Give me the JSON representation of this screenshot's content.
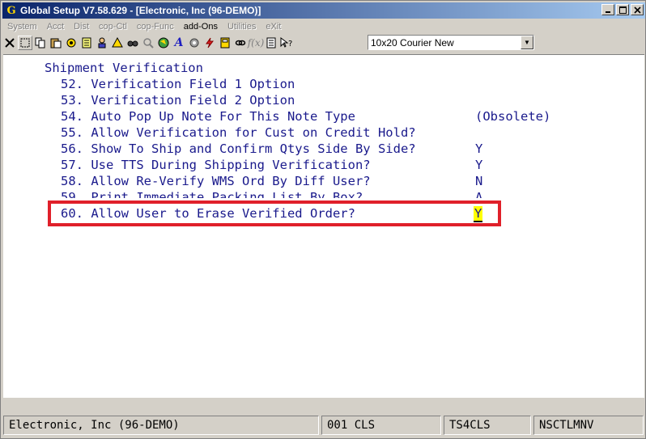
{
  "window": {
    "title": "Global Setup V7.58.629 - [Electronic, Inc (96-DEMO)]",
    "app_icon": "app-logo-icon",
    "buttons": [
      "minimize",
      "maximize",
      "close"
    ]
  },
  "menu": {
    "items": [
      {
        "label": "System",
        "active": false
      },
      {
        "label": "Acct",
        "active": false
      },
      {
        "label": "Dist",
        "active": false
      },
      {
        "label": "cop-Ctl",
        "active": false
      },
      {
        "label": "cop-Func",
        "active": false
      },
      {
        "label": "add-Ons",
        "active": true
      },
      {
        "label": "Utilities",
        "active": false
      },
      {
        "label": "eXit",
        "active": false
      }
    ]
  },
  "toolbar": {
    "icons": [
      "close-x-icon",
      "select-icon",
      "copy-icon",
      "paste-icon",
      "settings-icon",
      "notes-icon",
      "user-icon",
      "alert-icon",
      "find-icon",
      "search-icon",
      "globe-icon",
      "font-icon",
      "gear-icon",
      "lightning-icon",
      "calculator-icon",
      "link-icon",
      "function-icon",
      "list-icon",
      "help-pointer-icon"
    ],
    "font_select": "10x20 Courier New"
  },
  "screen": {
    "section_title": "Shipment Verification",
    "lines": [
      {
        "num": "52.",
        "text": "Verification Field 1 Option",
        "answer": ""
      },
      {
        "num": "53.",
        "text": "Verification Field 2 Option",
        "answer": ""
      },
      {
        "num": "54.",
        "text": "Auto Pop Up Note For This Note Type",
        "answer": "(Obsolete)"
      },
      {
        "num": "55.",
        "text": "Allow Verification for Cust on Credit Hold?",
        "answer": ""
      },
      {
        "num": "56.",
        "text": "Show To Ship and Confirm Qtys Side By Side?",
        "answer": "Y"
      },
      {
        "num": "57.",
        "text": "Use TTS During Shipping Verification?",
        "answer": "Y"
      },
      {
        "num": "58.",
        "text": "Allow Re-Verify WMS Ord By Diff User?",
        "answer": "N"
      },
      {
        "num": "59.",
        "text": "Print Immediate Packing List By Box?",
        "answer": "A"
      }
    ],
    "current": {
      "num": "60.",
      "text": "Allow User to Erase Verified Order?",
      "answer": "Y"
    }
  },
  "status": {
    "company": "Electronic, Inc (96-DEMO)",
    "code": "001 CLS",
    "terminal": "TS4CLS",
    "program": "NSCTLMNV"
  }
}
